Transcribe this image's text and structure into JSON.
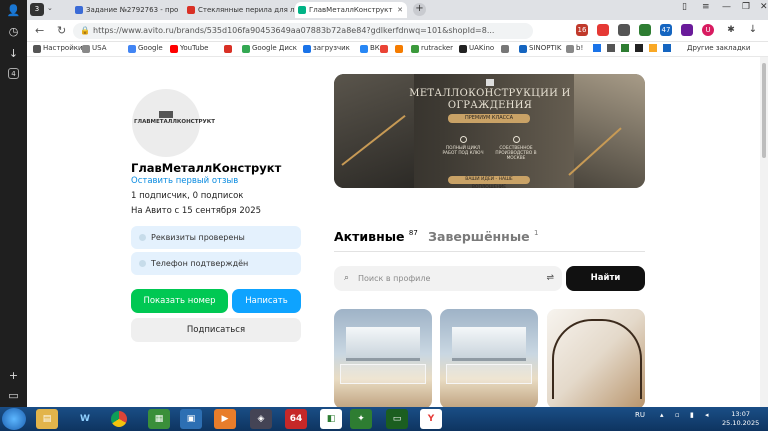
{
  "browser": {
    "tabs": [
      {
        "label": "Задание №2792763 - про",
        "favicon_color": "#3b6bd6"
      },
      {
        "label": "Стеклянные перила для л",
        "favicon_color": "#d93025"
      },
      {
        "label": "ГлавМеталлКонструкт",
        "favicon_color": "#00b386"
      }
    ],
    "tab_count": "3",
    "url": "https://www.avito.ru/brands/535d106fa90453649aa07883b72a8e84?gdlkerfdnwq=101&shopId=8...",
    "bookmarks": [
      {
        "label": "Настройки",
        "color": "#555"
      },
      {
        "label": "USA",
        "color": "#888"
      },
      {
        "label": "Google",
        "color": "#4285f4"
      },
      {
        "label": "YouTube",
        "color": "#ff0000"
      },
      {
        "label": "",
        "color": "#d93025"
      },
      {
        "label": "Google Диск",
        "color": "#34a853"
      },
      {
        "label": "загрузчик",
        "color": "#1a73e8"
      },
      {
        "label": "ВК",
        "color": "#2787f5"
      },
      {
        "label": "",
        "color": "#ea4335"
      },
      {
        "label": "",
        "color": "#f57c00"
      },
      {
        "label": "rutracker",
        "color": "#3c9a3c"
      },
      {
        "label": "UAKino",
        "color": "#222"
      },
      {
        "label": "",
        "color": "#777"
      },
      {
        "label": "SINOPTIK",
        "color": "#1565c0"
      },
      {
        "label": "b!",
        "color": "#888"
      }
    ],
    "other_bookmarks": "Другие закладки"
  },
  "profile": {
    "logo_text": "ГЛАВМЕТАЛЛКОНСТРУКТ",
    "name": "ГлавМеталлКонструкт",
    "review_link": "Оставить первый отзыв",
    "subscriptions": "1 подписчик, 0 подписок",
    "since": "На Авито с 15 сентября 2025",
    "badges": [
      "Реквизиты проверены",
      "Телефон подтверждён"
    ],
    "show_phone": "Показать номер",
    "write": "Написать",
    "subscribe": "Подписаться"
  },
  "banner": {
    "title": "МЕТАЛЛОКОНСТРУКЦИИ И ОГРАЖДЕНИЯ",
    "pill": "ПРЕМИУМ КЛАССА",
    "features": [
      "ПОЛНЫЙ ЦИКЛ РАБОТ ПОД КЛЮЧ",
      "СОБСТВЕННОЕ ПРОИЗВОДСТВО В МОСКВЕ"
    ],
    "footer": "ВАШИ ИДЕИ - НАШЕ ВОПЛОЩЕНИЕ"
  },
  "listings": {
    "active_label": "Активные",
    "active_count": "87",
    "done_label": "Завершённые",
    "done_count": "1",
    "search_placeholder": "Поиск в профиле",
    "find": "Найти"
  },
  "taskbar": {
    "lang": "RU",
    "time": "13:07",
    "date": "25.10.2025"
  }
}
